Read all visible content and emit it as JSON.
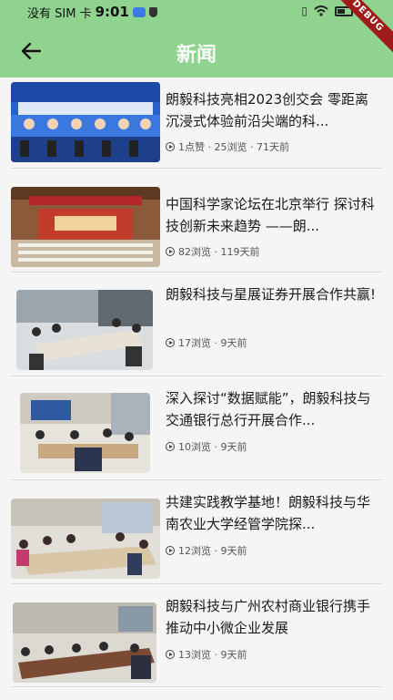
{
  "status_bar": {
    "carrier": "没有 SIM 卡",
    "time": "9:01",
    "signal_text": "ıD|"
  },
  "debug_banner": "DEBUG",
  "app_bar": {
    "title": "新闻"
  },
  "news": [
    {
      "title": "朗毅科技亮相2023创交会 零距离沉浸式体验前沿尖端的科...",
      "meta": "1点赞 · 25浏览 · 71天前",
      "image": "conference-forum-stage-photo"
    },
    {
      "title": "中国科学家论坛在北京举行 探讨科技创新未来趋势 ——朗...",
      "meta": "82浏览 · 119天前",
      "image": "scientist-forum-hall-photo"
    },
    {
      "title": "朗毅科技与星展证券开展合作共赢!",
      "meta": "17浏览 · 9天前",
      "image": "meeting-room-photo"
    },
    {
      "title": "深入探讨“数据赋能”，朗毅科技与交通银行总行开展合作...",
      "meta": "10浏览 · 9天前",
      "image": "meeting-table-photo"
    },
    {
      "title": "共建实践教学基地！朗毅科技与华南农业大学经管学院探...",
      "meta": "12浏览 · 9天前",
      "image": "university-meeting-photo"
    },
    {
      "title": "朗毅科技与广州农村商业银行携手推动中小微企业发展",
      "meta": "13浏览 · 9天前",
      "image": "bank-meeting-photo"
    }
  ]
}
